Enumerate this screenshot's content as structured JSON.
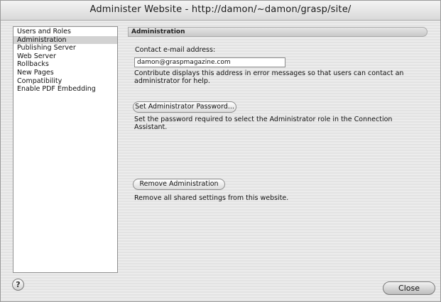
{
  "window": {
    "title": "Administer Website - http://damon/~damon/grasp/site/"
  },
  "sidebar": {
    "items": [
      {
        "label": "Users and Roles",
        "selected": false
      },
      {
        "label": "Administration",
        "selected": true
      },
      {
        "label": "Publishing Server",
        "selected": false
      },
      {
        "label": "Web Server",
        "selected": false
      },
      {
        "label": "Rollbacks",
        "selected": false
      },
      {
        "label": "New Pages",
        "selected": false
      },
      {
        "label": "Compatibility",
        "selected": false
      },
      {
        "label": "Enable PDF Embedding",
        "selected": false
      }
    ]
  },
  "main": {
    "section_title": "Administration",
    "email_label": "Contact e-mail address:",
    "email_value": "damon@graspmagazine.com",
    "email_help_line1": "Contribute displays this address in error messages so that users can contact an",
    "email_help_line2": "administrator for help.",
    "set_password_button": "Set Administrator Password...",
    "password_help_line1": "Set the password required to select the Administrator role in the Connection",
    "password_help_line2": "Assistant.",
    "remove_button": "Remove Administration",
    "remove_help": "Remove all shared settings from this website."
  },
  "footer": {
    "help_icon_glyph": "?",
    "close_label": "Close"
  }
}
